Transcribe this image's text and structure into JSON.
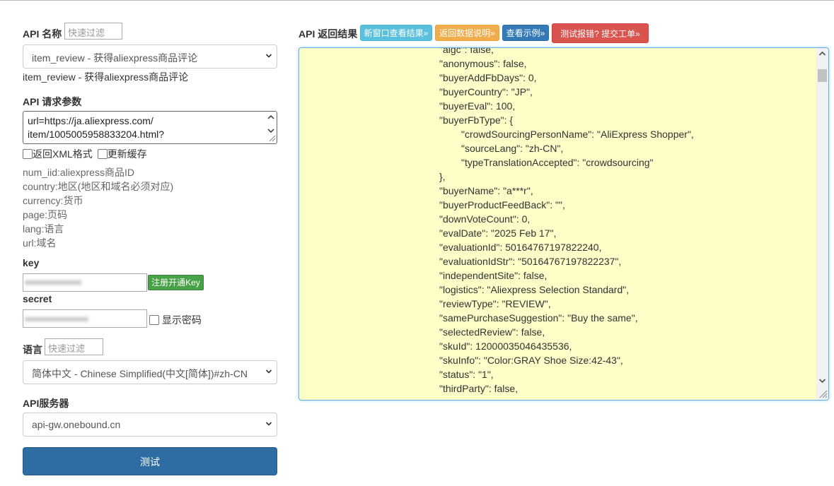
{
  "left": {
    "api_name_label": "API 名称",
    "filter_placeholder": "快速过滤",
    "api_select_value": "item_review - 获得aliexpress商品评论",
    "api_name_text": "item_review - 获得aliexpress商品评论",
    "params_label": "API 请求参数",
    "params_value_line1": "url=https://ja.aliexpress.com/",
    "params_value_line2": "item/1005005958833204.html?",
    "opt_xml": "返回XML格式",
    "opt_cache": "更新缓存",
    "param_desc": [
      "num_iid:aliexpress商品ID",
      "country:地区(地区和域名必须对应)",
      "currency:货币",
      "page:页码",
      "lang:语言",
      "url:域名"
    ],
    "key_label": "key",
    "register_key": "注册开通Key",
    "secret_label": "secret",
    "show_password": "显示密码",
    "lang_label": "语言",
    "lang_select_value": "简体中文 - Chinese Simplified(中文[简体])#zh-CN",
    "server_label": "API服务器",
    "server_select_value": "api-gw.onebound.cn",
    "test_button": "测试"
  },
  "right": {
    "result_label": "API 返回结果",
    "btn_new_window": "新窗口查看结果»",
    "btn_return_desc": "返回数据说明»",
    "btn_example": "查看示例»",
    "btn_report": "测试报错? 提交工单»",
    "btn_colors": {
      "info": "#5bc0de",
      "warning": "#f0ad4e",
      "primary": "#337ab7",
      "danger": "#d9534f"
    },
    "lines": [
      "\"aigc\": false,",
      "\"anonymous\": false,",
      "\"buyerAddFbDays\": 0,",
      "\"buyerCountry\": \"JP\",",
      "\"buyerEval\": 100,",
      "\"buyerFbType\": {",
      "\"crowdSourcingPersonName\": \"AliExpress Shopper\",",
      "\"sourceLang\": \"zh-CN\",",
      "\"typeTranslationAccepted\": \"crowdsourcing\"",
      "},",
      "\"buyerName\": \"a***r\",",
      "\"buyerProductFeedBack\": \"\",",
      "\"downVoteCount\": 0,",
      "\"evalDate\": \"2025 Feb 17\",",
      "\"evaluationId\": 50164767197822240,",
      "\"evaluationIdStr\": \"50164767197822237\",",
      "\"independentSite\": false,",
      "\"logistics\": \"Aliexpress Selection Standard\",",
      "\"reviewType\": \"REVIEW\",",
      "\"samePurchaseSuggestion\": \"Buy the same\",",
      "\"selectedReview\": false,",
      "\"skuId\": 12000035046435536,",
      "\"skuInfo\": \"Color:GRAY Shoe Size:42-43\",",
      "\"status\": \"1\",",
      "\"thirdParty\": false,"
    ]
  }
}
